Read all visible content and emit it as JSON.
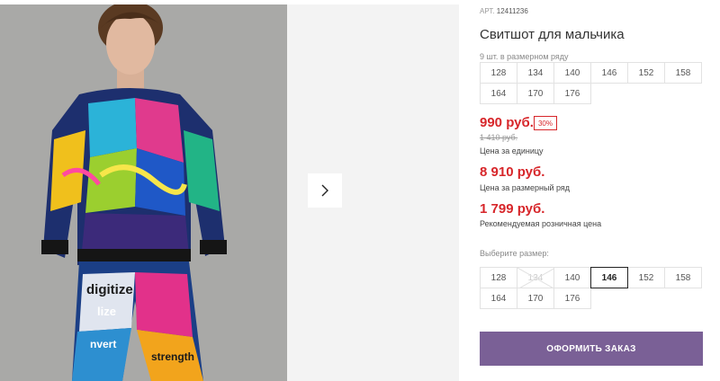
{
  "product": {
    "article_label": "АРТ.",
    "article_number": "12411236",
    "title": "Свитшот для мальчика",
    "pack_label": "9 шт. в размерном ряду",
    "pack_sizes": [
      [
        "128",
        "134",
        "140",
        "146",
        "152",
        "158"
      ],
      [
        "164",
        "170",
        "176"
      ]
    ]
  },
  "pricing": {
    "price": "990 руб.",
    "discount": "30%",
    "old_price": "1 410 руб.",
    "price_caption": "Цена за единицу",
    "pack_price": "8 910 руб.",
    "pack_caption": "Цена за размерный ряд",
    "retail_price": "1 799 руб.",
    "retail_caption": "Рекомендуемая розничная цена"
  },
  "size_select": {
    "label": "Выберите размер:",
    "selected": "146",
    "unavailable": [
      "134"
    ],
    "sizes": [
      [
        "128",
        "134",
        "140",
        "146",
        "152",
        "158"
      ],
      [
        "164",
        "170",
        "176"
      ]
    ]
  },
  "order_button": "ОФОРМИТЬ ЗАКАЗ",
  "gallery": {
    "next_icon": "chevron-right-icon",
    "photo_text": [
      "digitize",
      "lize",
      "nvert",
      "strength"
    ]
  },
  "colors": {
    "price_red": "#d7262a",
    "button_purple": "#7a6096"
  }
}
